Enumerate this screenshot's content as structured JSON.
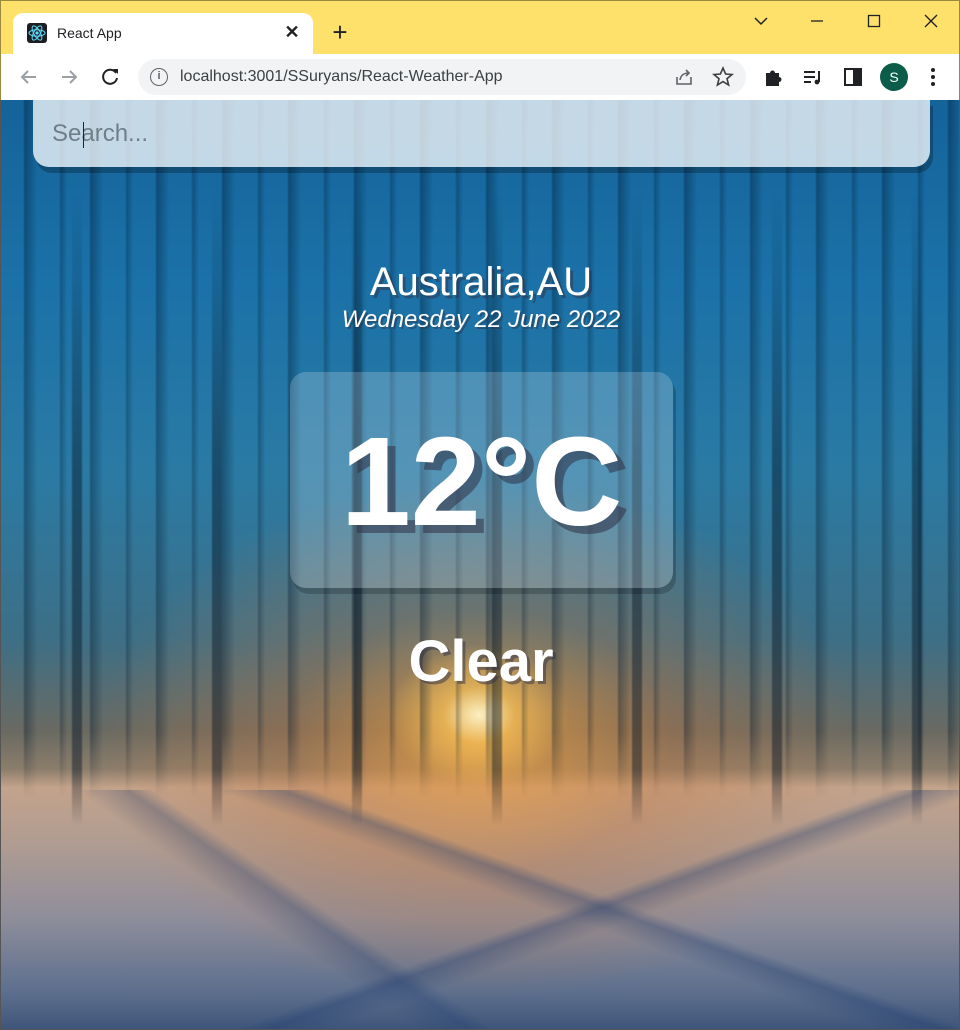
{
  "browser": {
    "tab_title": "React App",
    "tab_close": "✕",
    "new_tab": "+",
    "url": "localhost:3001/SSuryans/React-Weather-App",
    "profile_initial": "S",
    "icons": {
      "favicon": "react-logo-icon",
      "back": "arrow-left-icon",
      "forward": "arrow-right-icon",
      "reload": "reload-icon",
      "info": "info-icon",
      "share": "share-icon",
      "bookmark": "star-icon",
      "extensions": "puzzle-icon",
      "media": "media-queue-icon",
      "side_panel": "side-panel-icon",
      "menu": "kebab-menu-icon"
    },
    "colors": {
      "titlebar": "#fde16a",
      "avatar": "#0b5c49"
    }
  },
  "weather": {
    "search_placeholder": "Search...",
    "location": "Australia,AU",
    "date": "Wednesday 22 June 2022",
    "temperature": "12°C",
    "condition": "Clear"
  }
}
